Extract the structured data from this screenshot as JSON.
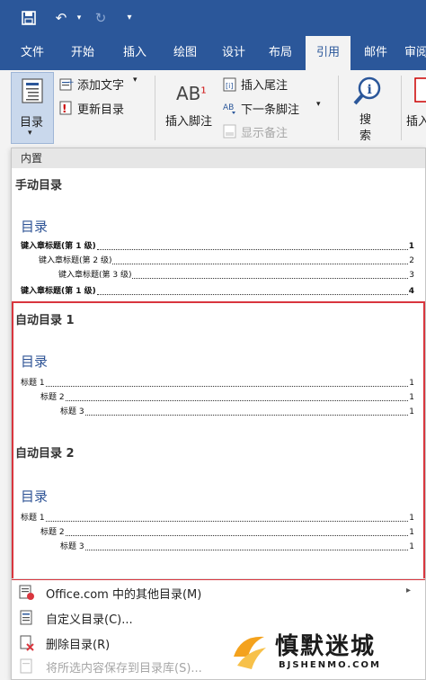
{
  "ribbon": {
    "tabs": [
      "文件",
      "开始",
      "插入",
      "绘图",
      "设计",
      "布局",
      "引用",
      "邮件",
      "审阅"
    ],
    "active_tab": "引用",
    "toc_button_label": "目录",
    "add_text_label": "添加文字",
    "update_toc_label": "更新目录",
    "insert_footnote_label": "插入脚注",
    "ab_glyph": "AB",
    "ab_sup": "1",
    "insert_endnote_label": "插入尾注",
    "next_footnote_label": "下一条脚注",
    "show_notes_label": "显示备注",
    "search_label_1": "搜",
    "search_label_2": "索",
    "insert_partial_label": "插入"
  },
  "dropdown": {
    "section_header": "内置",
    "galleries": [
      {
        "title": "手动目录",
        "heading": "目录",
        "entries": [
          {
            "text": "键入章标题(第 1 级)",
            "page": "1",
            "level": 1
          },
          {
            "text": "键入章标题(第 2 级)",
            "page": "2",
            "level": 2
          },
          {
            "text": "键入章标题(第 3 级)",
            "page": "3",
            "level": 3
          },
          {
            "text": "键入章标题(第 1 级)",
            "page": "4",
            "level": 1
          }
        ]
      },
      {
        "title": "自动目录 1",
        "heading": "目录",
        "entries": [
          {
            "text": "标题 1",
            "page": "1",
            "level": 1
          },
          {
            "text": "标题 2",
            "page": "1",
            "level": 2
          },
          {
            "text": "标题 3",
            "page": "1",
            "level": 3
          }
        ]
      },
      {
        "title": "自动目录 2",
        "heading": "目录",
        "entries": [
          {
            "text": "标题 1",
            "page": "1",
            "level": 1
          },
          {
            "text": "标题 2",
            "page": "1",
            "level": 2
          },
          {
            "text": "标题 3",
            "page": "1",
            "level": 3
          }
        ]
      }
    ],
    "menu": {
      "more_toc": "Office.com 中的其他目录(M)",
      "custom_toc": "自定义目录(C)...",
      "remove_toc": "删除目录(R)",
      "save_selection": "将所选内容保存到目录库(S)..."
    }
  },
  "watermark": {
    "name": "慎默迷城",
    "site": "BJSHENMO.COM"
  },
  "colors": {
    "ribbon_blue": "#2b579a",
    "highlight_red": "#d9363e",
    "toc_heading_blue": "#2f5496"
  }
}
